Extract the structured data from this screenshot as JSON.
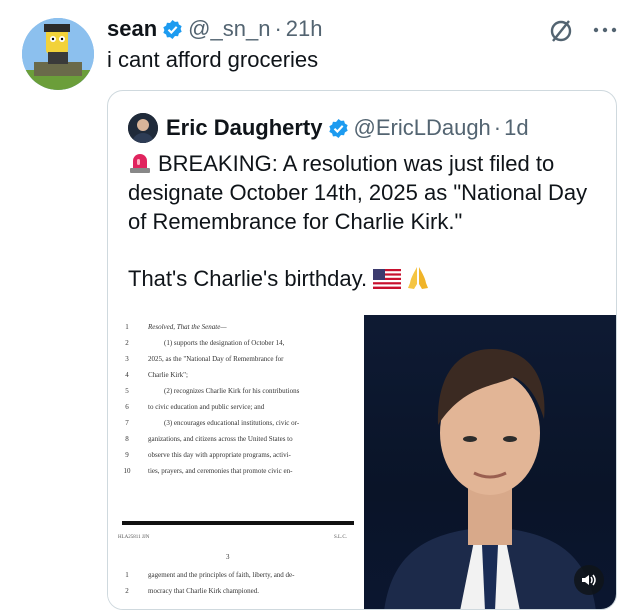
{
  "tweet": {
    "author_name": "sean",
    "author_handle": "@_sn_n",
    "separator": "·",
    "time": "21h",
    "text": "i cant afford groceries",
    "icons": {
      "verified": "verified-badge-icon",
      "mute": "muted-slash-icon",
      "more": "more-horizontal-icon"
    }
  },
  "quote": {
    "author_name": "Eric Daugherty",
    "author_handle": "@EricLDaugh",
    "separator": "·",
    "time": "1d",
    "line1": "BREAKING: A resolution was just filed to designate October 14th, 2025 as \"National Day of Remembrance for Charlie Kirk.\"",
    "line2": "That's Charlie's birthday.",
    "emojis": [
      "siren-emoji",
      "us-flag-emoji",
      "folded-hands-emoji"
    ],
    "document": {
      "lines": [
        {
          "n": "1",
          "t": "Resolved, That the Senate—"
        },
        {
          "n": "2",
          "t": "(1) supports the designation of October 14,"
        },
        {
          "n": "3",
          "t": "2025, as the \"National Day of Remembrance for"
        },
        {
          "n": "4",
          "t": "Charlie Kirk\";"
        },
        {
          "n": "5",
          "t": "(2) recognizes Charlie Kirk for his contributions"
        },
        {
          "n": "6",
          "t": "to civic education and public service; and"
        },
        {
          "n": "7",
          "t": "(3) encourages educational institutions, civic or-"
        },
        {
          "n": "8",
          "t": "ganizations, and citizens across the United States to"
        },
        {
          "n": "9",
          "t": "observe this day with appropriate programs, activi-"
        },
        {
          "n": "10",
          "t": "ties, prayers, and ceremonies that promote civic en-"
        }
      ],
      "footer_left": "HLA25811 JJN",
      "footer_right": "S.L.C.",
      "page_number": "3",
      "lines2": [
        {
          "n": "1",
          "t": "gagement and the principles of faith, liberty, and de-"
        },
        {
          "n": "2",
          "t": "mocracy that Charlie Kirk championed."
        }
      ]
    },
    "photo_icon": "volume-on-icon"
  },
  "colors": {
    "accent_blue": "#1d9bf0",
    "muted_text": "#536471",
    "border": "#cfd9de"
  }
}
